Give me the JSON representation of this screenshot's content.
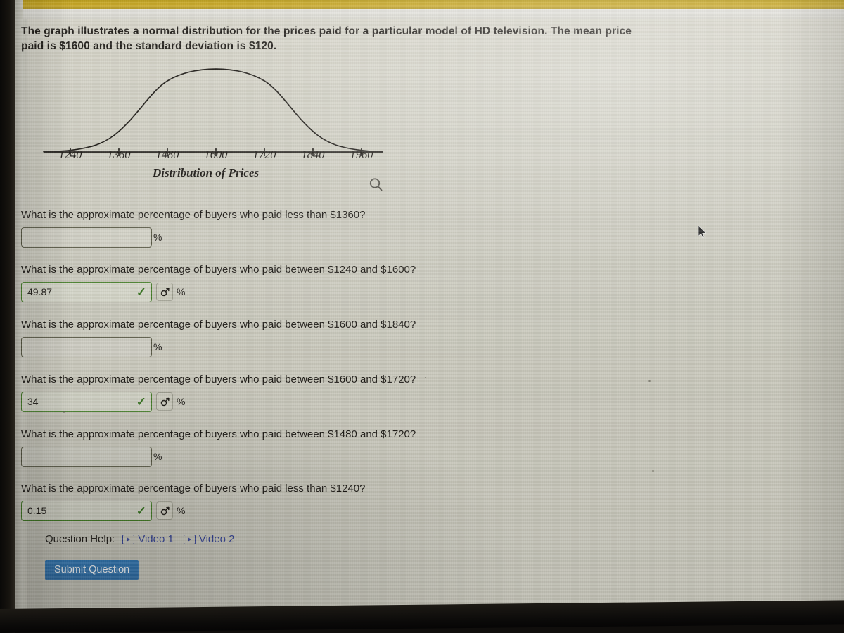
{
  "prompt": "The graph illustrates a normal distribution for the prices paid for a particular model of HD television. The mean price paid is $1600 and the standard deviation is $120.",
  "figure": {
    "caption": "Distribution of Prices",
    "magnifier_icon": "search-icon"
  },
  "chart_data": {
    "type": "line",
    "title": "",
    "subtitle": "",
    "xlabel": "Distribution of Prices",
    "ylabel": "",
    "grid": false,
    "legend": null,
    "tick_labels": [
      "1240",
      "1360",
      "1480",
      "1600",
      "1720",
      "1840",
      "1960"
    ],
    "x": [
      1240,
      1360,
      1480,
      1600,
      1720,
      1840,
      1960
    ],
    "xlim": [
      1180,
      2020
    ],
    "distribution": {
      "name": "normal",
      "mean": 1600,
      "std_dev": 120
    },
    "curve": {
      "x": [
        1180,
        1240,
        1300,
        1360,
        1420,
        1480,
        1540,
        1600,
        1660,
        1720,
        1780,
        1840,
        1900,
        1960,
        2020
      ],
      "y": [
        0.0003,
        0.0044,
        0.0324,
        0.1353,
        0.3247,
        0.6065,
        0.8825,
        1.0,
        0.8825,
        0.6065,
        0.3247,
        0.1353,
        0.0324,
        0.0044,
        0.0003
      ]
    }
  },
  "questions": [
    {
      "text": "What is the approximate percentage of buyers who paid less than $1360?",
      "value": "",
      "answered": false,
      "unit": "%"
    },
    {
      "text": "What is the approximate percentage of buyers who paid between $1240 and $1600?",
      "value": "49.87",
      "answered": true,
      "unit": "%"
    },
    {
      "text": "What is the approximate percentage of buyers who paid between $1600 and $1840?",
      "value": "",
      "answered": false,
      "unit": "%"
    },
    {
      "text": "What is the approximate percentage of buyers who paid between $1600 and $1720?",
      "value": "34",
      "answered": true,
      "unit": "%"
    },
    {
      "text": "What is the approximate percentage of buyers who paid between $1480 and $1720?",
      "value": "",
      "answered": false,
      "unit": "%"
    },
    {
      "text": "What is the approximate percentage of buyers who paid less than $1240?",
      "value": "0.15",
      "answered": true,
      "unit": "%"
    }
  ],
  "help": {
    "label": "Question Help:",
    "video1": "Video 1",
    "video2": "Video 2"
  },
  "submit": {
    "label": "Submit Question"
  },
  "colors": {
    "correct_border": "#3f7a22",
    "check": "#2f6e18",
    "submit_bg": "#2a6aa4",
    "link": "#2b3a8f",
    "top_band": "#c9a61c"
  }
}
